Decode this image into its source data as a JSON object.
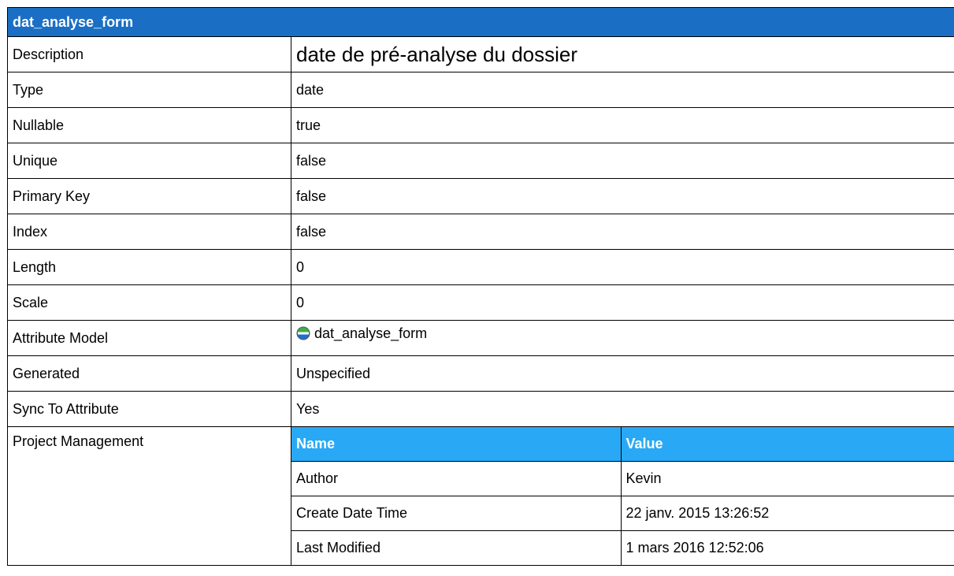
{
  "title": "dat_analyse_form",
  "rows": [
    {
      "label": "Description",
      "value": "date de pré-analyse du dossier"
    },
    {
      "label": "Type",
      "value": "date"
    },
    {
      "label": "Nullable",
      "value": "true"
    },
    {
      "label": "Unique",
      "value": "false"
    },
    {
      "label": "Primary Key",
      "value": "false"
    },
    {
      "label": "Index",
      "value": "false"
    },
    {
      "label": "Length",
      "value": "0"
    },
    {
      "label": "Scale",
      "value": "0"
    },
    {
      "label": "Attribute Model",
      "value": "dat_analyse_form",
      "icon": "attribute-icon"
    },
    {
      "label": "Generated",
      "value": "Unspecified"
    },
    {
      "label": "Sync To Attribute",
      "value": "Yes"
    },
    {
      "label": "Project Management"
    }
  ],
  "project_management": {
    "headers": {
      "name": "Name",
      "value": "Value"
    },
    "rows": [
      {
        "name": "Author",
        "value": "Kevin"
      },
      {
        "name": "Create Date Time",
        "value": "22 janv. 2015 13:26:52"
      },
      {
        "name": "Last Modified",
        "value": "1 mars 2016 12:52:06"
      }
    ]
  },
  "colors": {
    "title_bg": "#1a6fc4",
    "sub_header_bg": "#29a9f5",
    "icon_green": "#3cb043",
    "icon_blue": "#1e6fd0"
  }
}
